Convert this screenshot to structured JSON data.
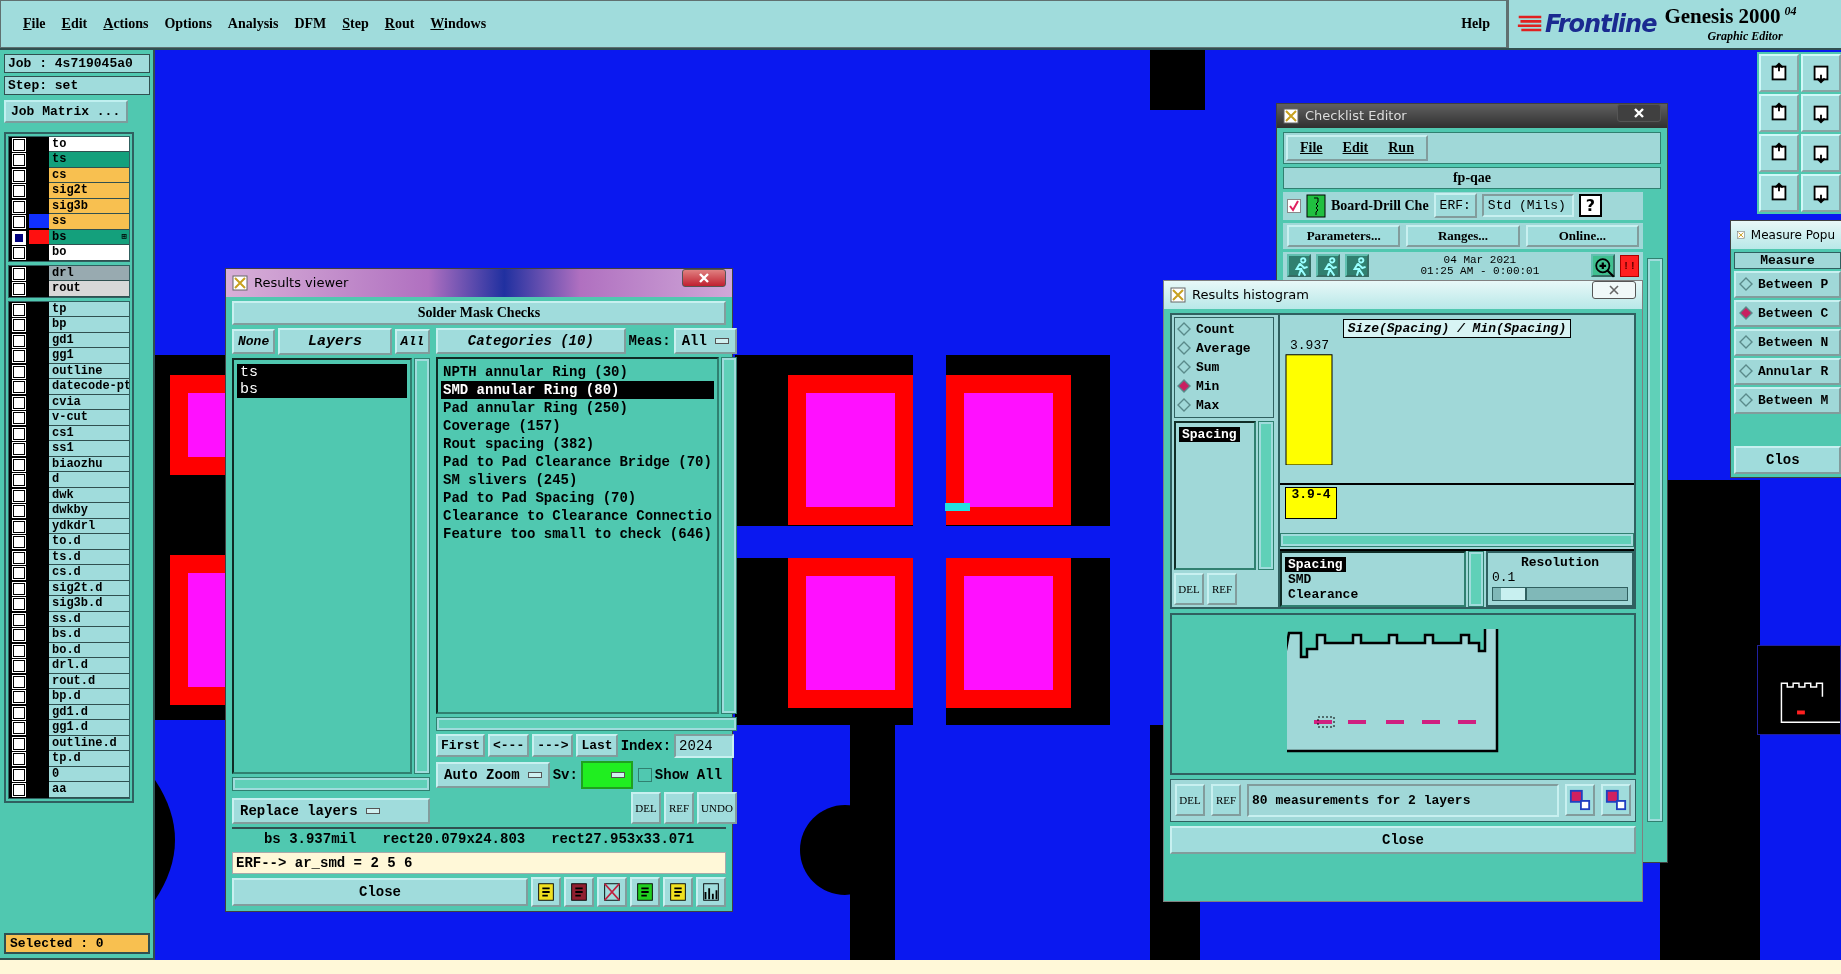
{
  "menu_bar": {
    "items": [
      {
        "label": "File",
        "underline_first": true
      },
      {
        "label": "Edit",
        "underline_first": true
      },
      {
        "label": "Actions",
        "underline_first": true
      },
      {
        "label": "Options",
        "underline_first": false
      },
      {
        "label": "Analysis",
        "underline_first": false
      },
      {
        "label": "DFM",
        "underline_first": false
      },
      {
        "label": "Step",
        "underline_first": true
      },
      {
        "label": "Rout",
        "underline_first": true
      },
      {
        "label": "Windows",
        "underline_first": true
      }
    ],
    "help": "Help"
  },
  "branding": {
    "logo": "Frontline",
    "product": "Genesis 2000",
    "version": "04",
    "subtitle": "Graphic Editor"
  },
  "job_panel": {
    "job": "Job : 4s719045a0",
    "step": "Step: set",
    "matrix_button": "Job Matrix ...",
    "layer_groups": [
      {
        "layers": [
          {
            "name": "to",
            "color": "#ffffff",
            "checked": false
          },
          {
            "name": "ts",
            "color": "#14a07c",
            "checked": false
          },
          {
            "name": "cs",
            "color": "#f8c050",
            "checked": false
          },
          {
            "name": "sig2t",
            "color": "#f8c050",
            "checked": false
          },
          {
            "name": "sig3b",
            "color": "#f8c050",
            "checked": false
          },
          {
            "name": "ss",
            "color": "#f8c050",
            "swatch": {
              "color": "#1030ff"
            },
            "checked": false
          },
          {
            "name": "bs",
            "color": "#14a07c",
            "swatch": {
              "color": "#ff1010"
            },
            "checked": true,
            "marker": "⊞"
          },
          {
            "name": "bo",
            "color": "#ffffff",
            "checked": false
          }
        ]
      },
      {
        "layers": [
          {
            "name": "drl",
            "color": "#98aab0",
            "checked": false
          },
          {
            "name": "rout",
            "color": "#d8d8d8",
            "checked": false
          }
        ]
      },
      {
        "layers": [
          {
            "name": "tp",
            "color": "#a0dcdc",
            "checked": false
          },
          {
            "name": "bp",
            "color": "#a0dcdc",
            "checked": false
          },
          {
            "name": "gd1",
            "color": "#a0dcdc",
            "checked": false
          },
          {
            "name": "gg1",
            "color": "#a0dcdc",
            "checked": false
          },
          {
            "name": "outline",
            "color": "#a0dcdc",
            "checked": false
          },
          {
            "name": "datecode-pt",
            "color": "#a0dcdc",
            "checked": false
          },
          {
            "name": "cvia",
            "color": "#a0dcdc",
            "checked": false
          },
          {
            "name": "v-cut",
            "color": "#a0dcdc",
            "checked": false
          },
          {
            "name": "cs1",
            "color": "#a0dcdc",
            "checked": false
          },
          {
            "name": "ss1",
            "color": "#a0dcdc",
            "checked": false
          },
          {
            "name": "biaozhu",
            "color": "#a0dcdc",
            "checked": false
          },
          {
            "name": "d",
            "color": "#a0dcdc",
            "checked": false
          },
          {
            "name": "dwk",
            "color": "#a0dcdc",
            "checked": false
          },
          {
            "name": "dwkby",
            "color": "#a0dcdc",
            "checked": false
          },
          {
            "name": "ydkdrl",
            "color": "#a0dcdc",
            "checked": false
          },
          {
            "name": "to.d",
            "color": "#a0dcdc",
            "checked": false
          },
          {
            "name": "ts.d",
            "color": "#a0dcdc",
            "checked": false
          },
          {
            "name": "cs.d",
            "color": "#a0dcdc",
            "checked": false
          },
          {
            "name": "sig2t.d",
            "color": "#a0dcdc",
            "checked": false
          },
          {
            "name": "sig3b.d",
            "color": "#a0dcdc",
            "checked": false
          },
          {
            "name": "ss.d",
            "color": "#a0dcdc",
            "checked": false
          },
          {
            "name": "bs.d",
            "color": "#a0dcdc",
            "checked": false
          },
          {
            "name": "bo.d",
            "color": "#a0dcdc",
            "checked": false
          },
          {
            "name": "drl.d",
            "color": "#a0dcdc",
            "checked": false
          },
          {
            "name": "rout.d",
            "color": "#a0dcdc",
            "checked": false
          },
          {
            "name": "bp.d",
            "color": "#a0dcdc",
            "checked": false
          },
          {
            "name": "gd1.d",
            "color": "#a0dcdc",
            "checked": false
          },
          {
            "name": "gg1.d",
            "color": "#a0dcdc",
            "checked": false
          },
          {
            "name": "outline.d",
            "color": "#a0dcdc",
            "checked": false
          },
          {
            "name": "tp.d",
            "color": "#a0dcdc",
            "checked": false
          },
          {
            "name": "0",
            "color": "#a0dcdc",
            "checked": false
          },
          {
            "name": "aa",
            "color": "#a0dcdc",
            "checked": false
          }
        ]
      }
    ],
    "selected_count": "Selected : 0"
  },
  "results_viewer": {
    "title": "Results viewer",
    "heading": "Solder Mask Checks",
    "layer_buttons": [
      "None",
      "Layers",
      "All"
    ],
    "layers": [
      {
        "name": "ts",
        "selected": true
      },
      {
        "name": "bs",
        "selected": true
      }
    ],
    "categories_button": "Categories (10)",
    "meas_label": "Meas:",
    "meas_value": "All",
    "categories": [
      {
        "label": "NPTH annular Ring (30)",
        "selected": false
      },
      {
        "label": "SMD annular Ring (80)",
        "selected": true
      },
      {
        "label": "Pad annular Ring (250)",
        "selected": false
      },
      {
        "label": "Coverage (157)",
        "selected": false
      },
      {
        "label": "Rout spacing (382)",
        "selected": false
      },
      {
        "label": "Pad to Pad Clearance Bridge (70)",
        "selected": false
      },
      {
        "label": "SM slivers (245)",
        "selected": false
      },
      {
        "label": "Pad to Pad Spacing (70)",
        "selected": false
      },
      {
        "label": "Clearance to Clearance Connectio",
        "selected": false
      },
      {
        "label": "Feature too small to check (646)",
        "selected": false
      }
    ],
    "nav": [
      "First",
      "<---",
      "--->",
      "Last"
    ],
    "index_label": "Index:",
    "index_value": "2024",
    "zoom_mode": "Auto Zoom",
    "sv_label": "Sv:",
    "show_all": {
      "label": "Show All",
      "checked": false
    },
    "layer_mode": "Replace layers",
    "edit_buttons": [
      "DEL",
      "REF",
      "UNDO"
    ],
    "status": [
      "bs 3.937mil",
      "rect20.079x24.803",
      "rect27.953x33.071"
    ],
    "erf_line": "ERF--> ar_smd = 2 5 6",
    "close": "Close"
  },
  "checklist_editor": {
    "title": "Checklist Editor",
    "menu": [
      "File",
      "Edit",
      "Run"
    ],
    "checklist_name": "fp-qae",
    "action": {
      "label": "Board-Drill Che",
      "checked": true
    },
    "erf_button": "ERF:",
    "erf_value": "Std (Mils)",
    "help_button": "?",
    "buttons": [
      "Parameters...",
      "Ranges...",
      "Online..."
    ],
    "date": "04 Mar 2021",
    "time": "01:25 AM - 0:00:01",
    "alert_button": "!!"
  },
  "results_histogram": {
    "title": "Results histogram",
    "stat_options": [
      {
        "label": "Count",
        "selected": false
      },
      {
        "label": "Average",
        "selected": false
      },
      {
        "label": "Sum",
        "selected": false
      },
      {
        "label": "Min",
        "selected": true
      },
      {
        "label": "Max",
        "selected": false
      }
    ],
    "attributes": [
      {
        "label": "Spacing",
        "selected": true
      }
    ],
    "side_buttons": [
      "DEL",
      "REF"
    ],
    "chart_data": {
      "type": "bar",
      "title": "Size(Spacing) / Min(Spacing)",
      "categories": [
        "3.9-4"
      ],
      "values": [
        3.937
      ],
      "ylim": [
        0,
        4
      ],
      "value_labels": [
        "3.937"
      ]
    },
    "measures": [
      {
        "label": "Spacing",
        "selected": true
      },
      {
        "label": "SMD",
        "selected": false
      },
      {
        "label": "Clearance",
        "selected": false
      }
    ],
    "resolution_label": "Resolution",
    "resolution_value": "0.1",
    "resolution_slider": {
      "level": 0.06
    },
    "footer_buttons": [
      "DEL",
      "REF"
    ],
    "summary": "80 measurements for 2 layers",
    "close": "Close"
  },
  "measure_popup": {
    "title": "Measure Popu",
    "heading": "Measure",
    "modes": [
      {
        "label": "Between P",
        "selected": false
      },
      {
        "label": "Between C",
        "selected": true
      },
      {
        "label": "Between N",
        "selected": false
      },
      {
        "label": "Annular R",
        "selected": false
      },
      {
        "label": "Between M",
        "selected": false
      }
    ],
    "close": "Clos"
  }
}
